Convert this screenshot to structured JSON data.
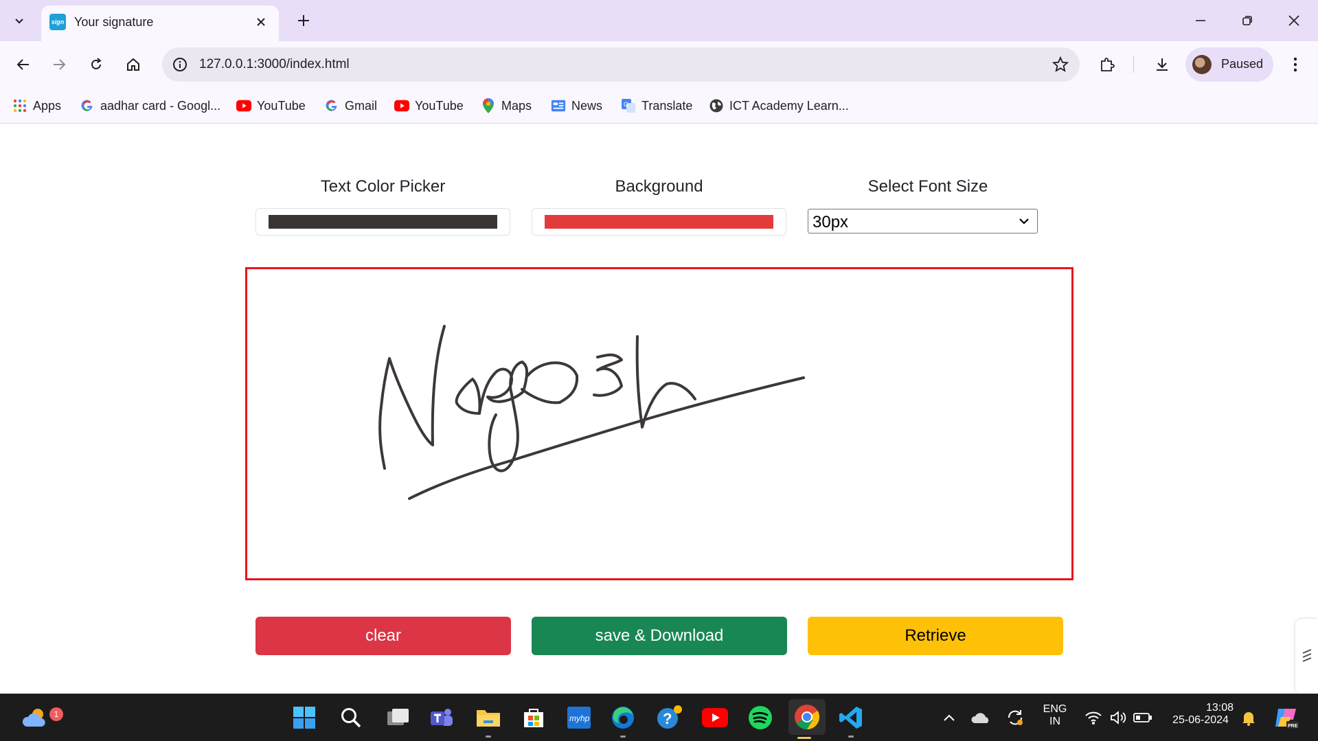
{
  "browser": {
    "tab_title": "Your signature",
    "favicon_text": "sign",
    "url": "127.0.0.1:3000/index.html",
    "profile_label": "Paused",
    "bookmarks": [
      {
        "label": "Apps",
        "icon": "apps-grid-icon"
      },
      {
        "label": "aadhar card - Googl...",
        "icon": "google-icon"
      },
      {
        "label": "YouTube",
        "icon": "youtube-icon"
      },
      {
        "label": "Gmail",
        "icon": "google-icon"
      },
      {
        "label": "YouTube",
        "icon": "youtube-icon"
      },
      {
        "label": "Maps",
        "icon": "maps-icon"
      },
      {
        "label": "News",
        "icon": "news-icon"
      },
      {
        "label": "Translate",
        "icon": "translate-icon"
      },
      {
        "label": "ICT Academy Learn...",
        "icon": "globe-icon"
      }
    ]
  },
  "app": {
    "text_color_label": "Text Color Picker",
    "background_label": "Background",
    "font_size_label": "Select Font Size",
    "text_color": "#3a3535",
    "background_color": "#e33b3b",
    "font_size_value": "30px",
    "canvas_border_color": "#e8141c",
    "signature_ink_color": "#3d3838",
    "buttons": {
      "clear": "clear",
      "save": "save & Download",
      "retrieve": "Retrieve"
    }
  },
  "taskbar": {
    "weather_badge": "1",
    "language_top": "ENG",
    "language_bottom": "IN",
    "time": "13:08",
    "date": "25-06-2024",
    "myhp_label": "myhp"
  }
}
